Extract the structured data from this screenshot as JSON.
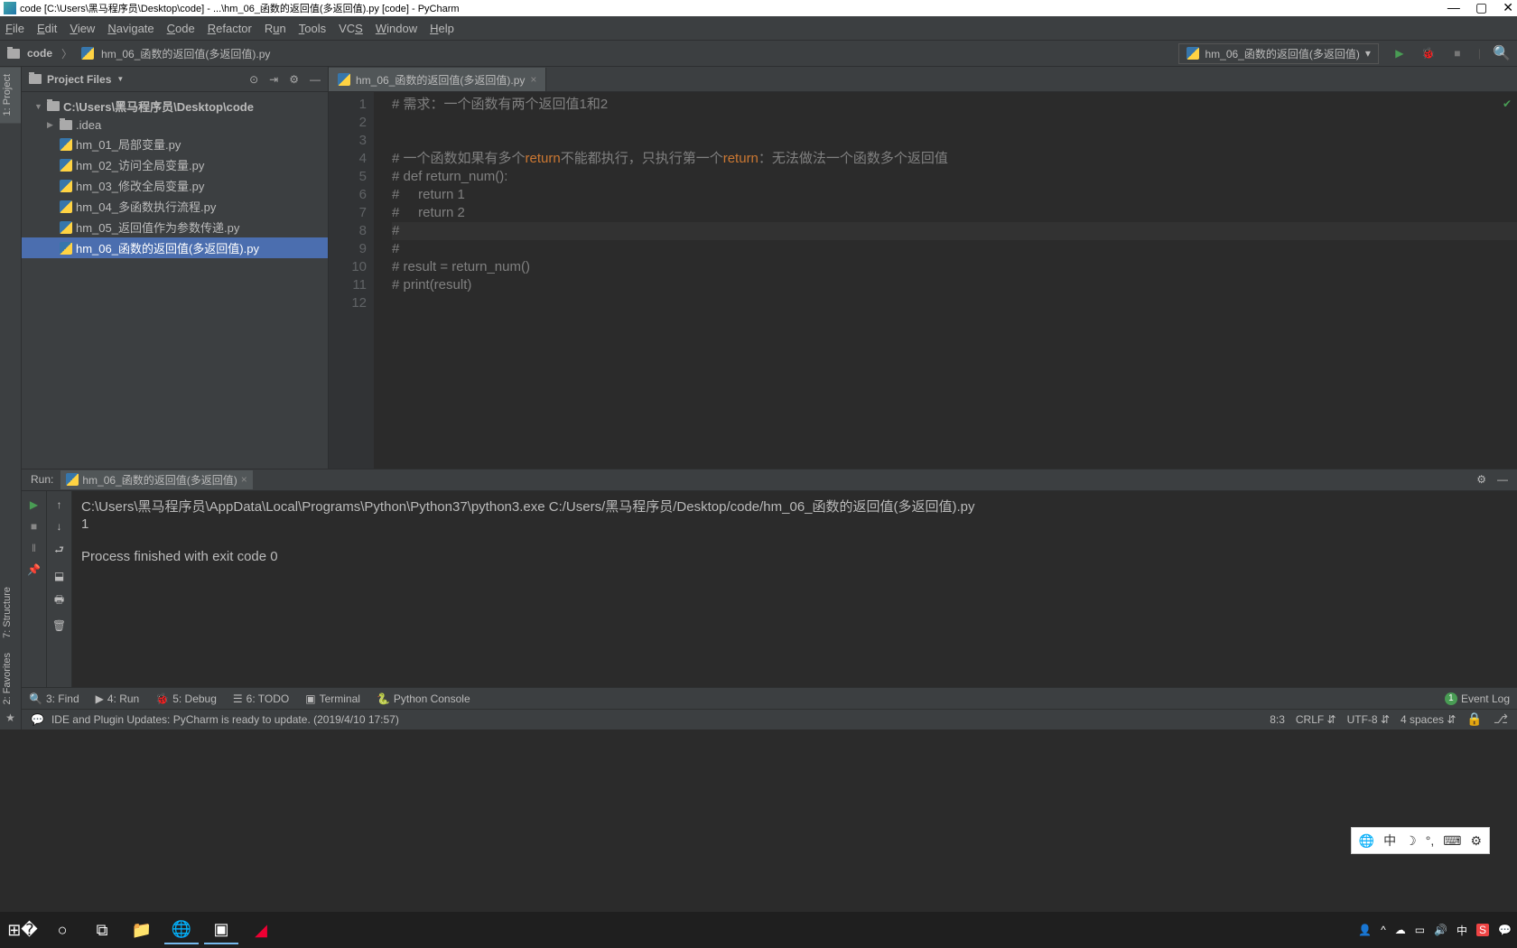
{
  "titlebar": {
    "text": "code [C:\\Users\\黑马程序员\\Desktop\\code] - ...\\hm_06_函数的返回值(多返回值).py [code] - PyCharm"
  },
  "menu": [
    "File",
    "Edit",
    "View",
    "Navigate",
    "Code",
    "Refactor",
    "Run",
    "Tools",
    "VCS",
    "Window",
    "Help"
  ],
  "breadcrumb": {
    "root": "code",
    "file": "hm_06_函数的返回值(多返回值).py"
  },
  "runconfig": "hm_06_函数的返回值(多返回值)",
  "project": {
    "panelTitle": "Project Files",
    "root": "C:\\Users\\黑马程序员\\Desktop\\code",
    "idea": ".idea",
    "files": [
      "hm_01_局部变量.py",
      "hm_02_访问全局变量.py",
      "hm_03_修改全局变量.py",
      "hm_04_多函数执行流程.py",
      "hm_05_返回值作为参数传递.py",
      "hm_06_函数的返回值(多返回值).py"
    ]
  },
  "vtabs": {
    "project": "1: Project",
    "structure": "7: Structure",
    "favorites": "2: Favorites"
  },
  "tab": "hm_06_函数的返回值(多返回值).py",
  "code": {
    "l1": "# 需求：一个函数有两个返回值1和2",
    "l2": "",
    "l3": "",
    "l4_a": "# 一个函数如果有多个",
    "l4_kw1": "return",
    "l4_b": "不能都执行，只执行第一个",
    "l4_kw2": "return",
    "l4_c": "：无法做法一个函数多个返回值",
    "l5": "# def return_num():",
    "l6": "#     return 1",
    "l7": "#     return 2",
    "l8": "#",
    "l9": "#",
    "l10": "# result = return_num()",
    "l11": "# print(result)",
    "l12": ""
  },
  "run": {
    "label": "Run:",
    "tab": "hm_06_函数的返回值(多返回值)",
    "out1": "C:\\Users\\黑马程序员\\AppData\\Local\\Programs\\Python\\Python37\\python3.exe C:/Users/黑马程序员/Desktop/code/hm_06_函数的返回值(多返回值).py",
    "out2": "1",
    "out3": "",
    "out4": "Process finished with exit code 0"
  },
  "bottomTools": {
    "find": "3: Find",
    "run": "4: Run",
    "debug": "5: Debug",
    "todo": "6: TODO",
    "terminal": "Terminal",
    "pyconsole": "Python Console",
    "eventlog": "Event Log"
  },
  "status": {
    "msg": "IDE and Plugin Updates: PyCharm is ready to update. (2019/4/10 17:57)",
    "pos": "8:3",
    "le": "CRLF",
    "enc": "UTF-8",
    "indent": "4 spaces"
  },
  "ime": {
    "a": "中",
    "b": "中"
  },
  "tray": {
    "net": "中"
  }
}
